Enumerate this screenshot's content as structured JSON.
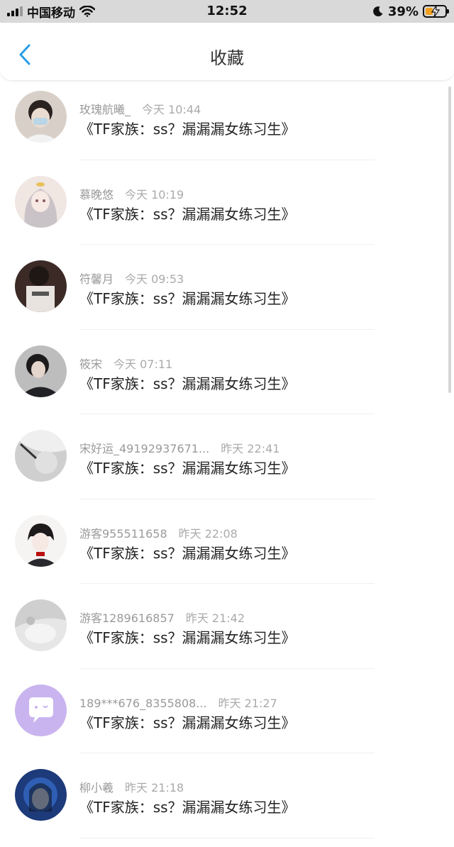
{
  "status_bar": {
    "carrier": "中国移动",
    "time": "12:52",
    "battery_percent": "39%",
    "battery_level": 0.39,
    "battery_color": "#f0a01e"
  },
  "header": {
    "title": "收藏",
    "back_icon": "chevron-left-icon",
    "accent": "#2b9de8"
  },
  "favorites": [
    {
      "user": "玫瑰航曦_",
      "time": "今天 10:44",
      "title": "《TF家族：ss？漏漏漏女练习生》"
    },
    {
      "user": "慕晚悠",
      "time": "今天 10:19",
      "title": "《TF家族：ss？漏漏漏女练习生》"
    },
    {
      "user": "符馨月",
      "time": "今天 09:53",
      "title": "《TF家族：ss？漏漏漏女练习生》"
    },
    {
      "user": "筱宋",
      "time": "今天 07:11",
      "title": "《TF家族：ss？漏漏漏女练习生》"
    },
    {
      "user": "宋好运_49192937671...",
      "time": "昨天 22:41",
      "title": "《TF家族：ss？漏漏漏女练习生》"
    },
    {
      "user": "游客955511658",
      "time": "昨天 22:08",
      "title": "《TF家族：ss？漏漏漏女练习生》"
    },
    {
      "user": "游客1289616857",
      "time": "昨天 21:42",
      "title": "《TF家族：ss？漏漏漏女练习生》"
    },
    {
      "user": "189***676_8355808...",
      "time": "昨天 21:27",
      "title": "《TF家族：ss？漏漏漏女练习生》"
    },
    {
      "user": "柳小羲",
      "time": "昨天 21:18",
      "title": "《TF家族：ss？漏漏漏女练习生》"
    }
  ]
}
